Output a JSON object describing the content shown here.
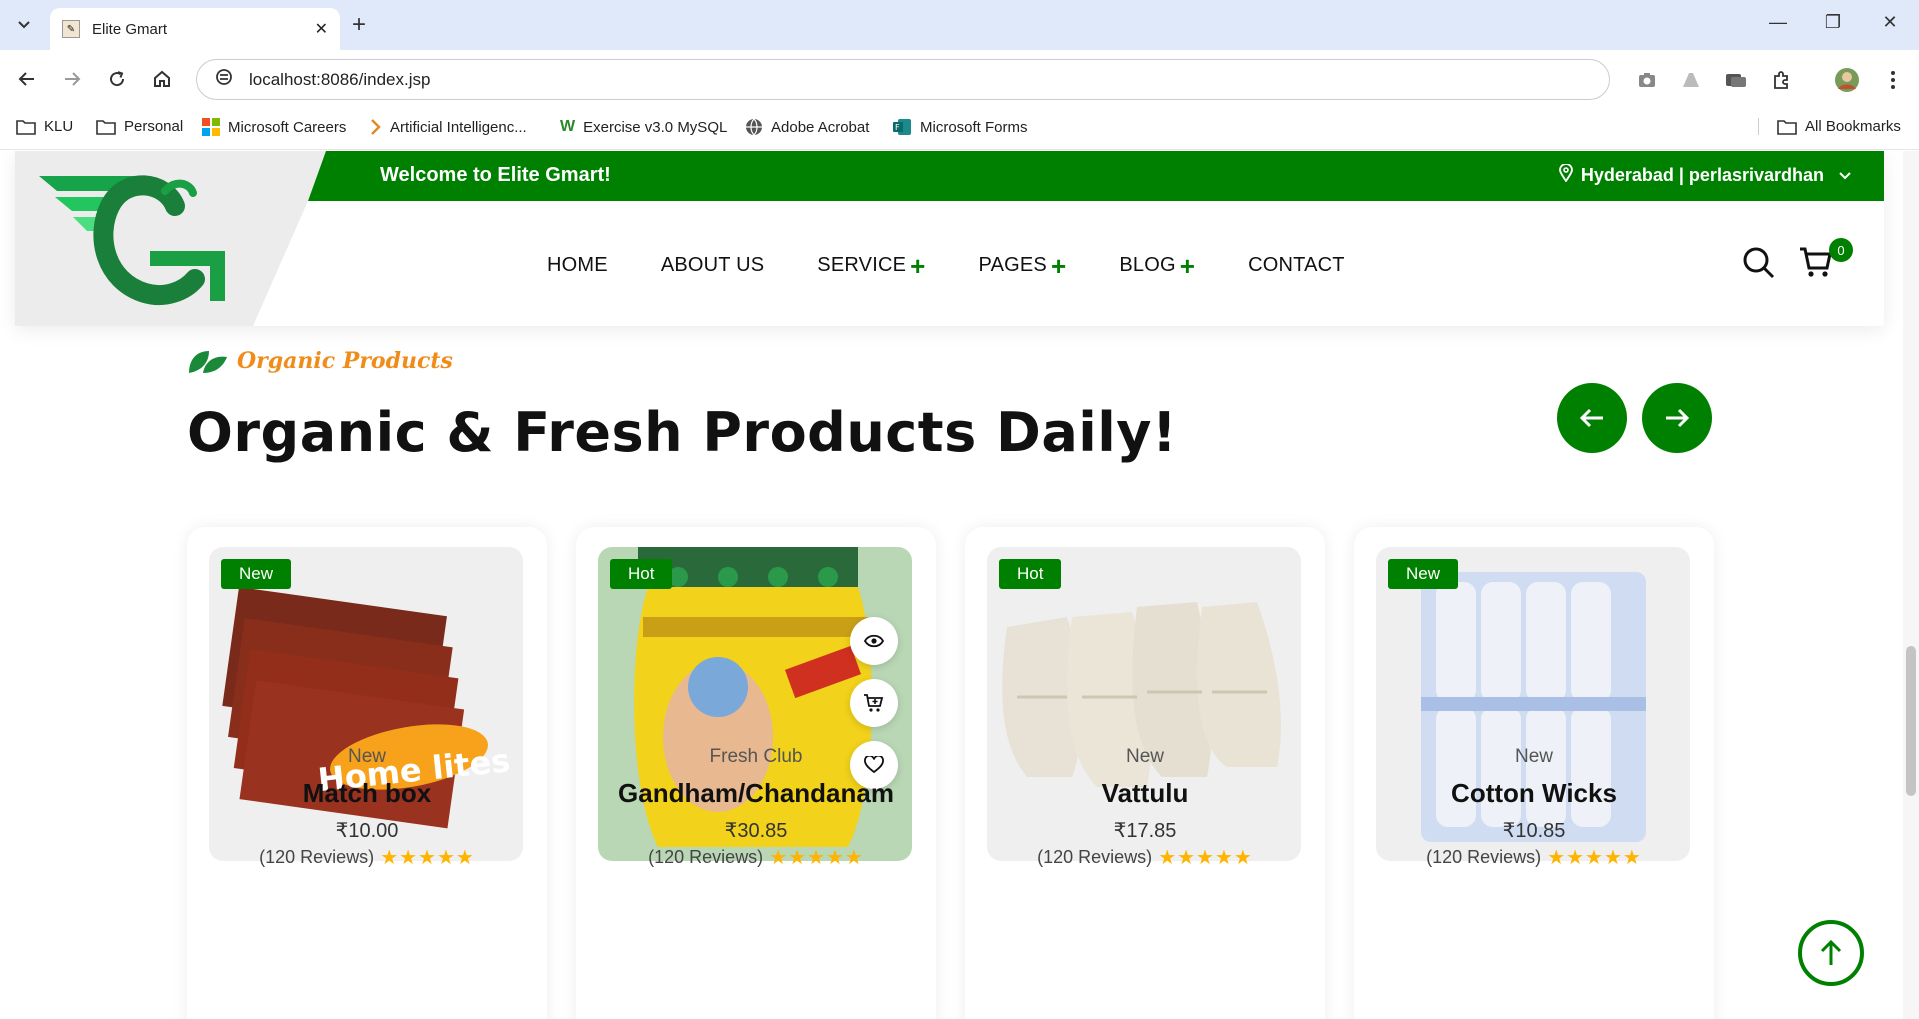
{
  "browser": {
    "tab_title": "Elite Gmart",
    "url": "localhost:8086/index.jsp",
    "bookmarks": [
      "KLU",
      "Personal",
      "Microsoft Careers",
      "Artificial Intelligenc...",
      "Exercise v3.0 MySQL",
      "Adobe Acrobat",
      "Microsoft Forms"
    ],
    "all_bookmarks": "All Bookmarks"
  },
  "header": {
    "welcome": "Welcome to Elite Gmart!",
    "location": "Hyderabad | perlasrivardhan",
    "nav": [
      "HOME",
      "ABOUT US",
      "SERVICE",
      "PAGES",
      "BLOG",
      "CONTACT"
    ],
    "cart_count": "0",
    "brand_color": "#008000"
  },
  "section": {
    "tag": "Organic Products",
    "title": "Organic & Fresh Products Daily!"
  },
  "products": [
    {
      "badge": "New",
      "category": "New",
      "name": "Match box",
      "price": "₹10.00",
      "reviews": "(120 Reviews)",
      "rating": 5
    },
    {
      "badge": "Hot",
      "category": "Fresh Club",
      "name": "Gandham/Chandanam",
      "price": "₹30.85",
      "reviews": "(120 Reviews)",
      "rating": 5
    },
    {
      "badge": "Hot",
      "category": "New",
      "name": "Vattulu",
      "price": "₹17.85",
      "reviews": "(120 Reviews)",
      "rating": 5
    },
    {
      "badge": "New",
      "category": "New",
      "name": "Cotton Wicks",
      "price": "₹10.85",
      "reviews": "(120 Reviews)",
      "rating": 5
    }
  ],
  "icons": {
    "quick_view": "eye-icon",
    "add_to_cart": "cart-plus-icon",
    "wishlist": "heart-icon",
    "back_to_top": "arrow-up-icon"
  }
}
